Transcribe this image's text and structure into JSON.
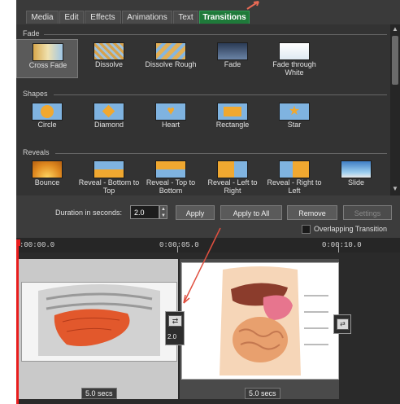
{
  "tabs": [
    {
      "label": "Media"
    },
    {
      "label": "Edit"
    },
    {
      "label": "Effects"
    },
    {
      "label": "Animations"
    },
    {
      "label": "Text"
    },
    {
      "label": "Transitions",
      "active": true
    }
  ],
  "sections": {
    "fade": {
      "title": "Fade",
      "items": [
        {
          "label": "Cross Fade",
          "selected": true,
          "icon": "cross-fade-icon"
        },
        {
          "label": "Dissolve",
          "icon": "dissolve-icon"
        },
        {
          "label": "Dissolve Rough",
          "icon": "dissolve-rough-icon"
        },
        {
          "label": "Fade",
          "icon": "fade-icon"
        },
        {
          "label": "Fade through White",
          "icon": "fade-white-icon"
        }
      ]
    },
    "shapes": {
      "title": "Shapes",
      "items": [
        {
          "label": "Circle",
          "icon": "circle-icon"
        },
        {
          "label": "Diamond",
          "icon": "diamond-icon"
        },
        {
          "label": "Heart",
          "icon": "heart-icon"
        },
        {
          "label": "Rectangle",
          "icon": "rectangle-icon"
        },
        {
          "label": "Star",
          "icon": "star-icon"
        }
      ]
    },
    "reveals": {
      "title": "Reveals",
      "items": [
        {
          "label": "Bounce",
          "icon": "bounce-icon"
        },
        {
          "label": "Reveal - Bottom to Top",
          "icon": "reveal-bottom-top-icon"
        },
        {
          "label": "Reveal - Top to Bottom",
          "icon": "reveal-top-bottom-icon"
        },
        {
          "label": "Reveal - Left to Right",
          "icon": "reveal-left-right-icon"
        },
        {
          "label": "Reveal - Right to Left",
          "icon": "reveal-right-left-icon"
        },
        {
          "label": "Slide",
          "icon": "slide-icon"
        }
      ]
    }
  },
  "controls": {
    "duration_label": "Duration in seconds:",
    "duration_value": "2.0",
    "apply": "Apply",
    "apply_all": "Apply to All",
    "remove": "Remove",
    "settings": "Settings",
    "overlapping": "Overlapping Transition"
  },
  "ruler": {
    "t0": ":00:00.0",
    "t1": "0:00:05.0",
    "t2": "0:00:10.0"
  },
  "timeline": {
    "clip1_duration": "5.0 secs",
    "clip2_duration": "5.0 secs",
    "transition_duration": "2.0"
  },
  "colors": {
    "accent": "#1f7a3a",
    "playhead": "#e81d1d"
  }
}
